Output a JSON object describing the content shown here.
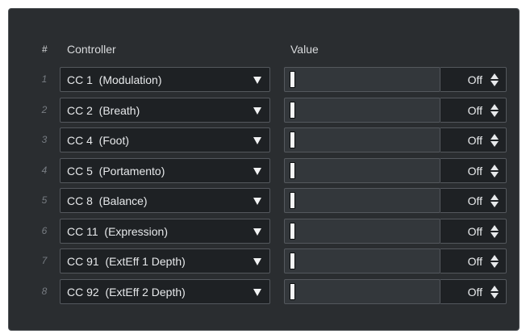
{
  "columns": {
    "number": "#",
    "controller": "Controller",
    "value": "Value"
  },
  "rows": [
    {
      "index": "1",
      "controller": "CC 1  (Modulation)",
      "value_label": "Off",
      "level": 0
    },
    {
      "index": "2",
      "controller": "CC 2  (Breath)",
      "value_label": "Off",
      "level": 0
    },
    {
      "index": "3",
      "controller": "CC 4  (Foot)",
      "value_label": "Off",
      "level": 0
    },
    {
      "index": "4",
      "controller": "CC 5  (Portamento)",
      "value_label": "Off",
      "level": 0
    },
    {
      "index": "5",
      "controller": "CC 8  (Balance)",
      "value_label": "Off",
      "level": 0
    },
    {
      "index": "6",
      "controller": "CC 11  (Expression)",
      "value_label": "Off",
      "level": 0
    },
    {
      "index": "7",
      "controller": "CC 91  (ExtEff 1 Depth)",
      "value_label": "Off",
      "level": 0
    },
    {
      "index": "8",
      "controller": "CC 92  (ExtEff 2 Depth)",
      "value_label": "Off",
      "level": 0
    }
  ],
  "icons": {
    "dropdown": "triangle-down-icon",
    "spinner": "up-down-arrows-icon"
  },
  "colors": {
    "panel_background": "#2a2d30",
    "field_background": "#1e2124",
    "slider_background": "#33373b",
    "border": "#54585d",
    "text": "#e7e9eb",
    "row_number": "#777c82"
  }
}
